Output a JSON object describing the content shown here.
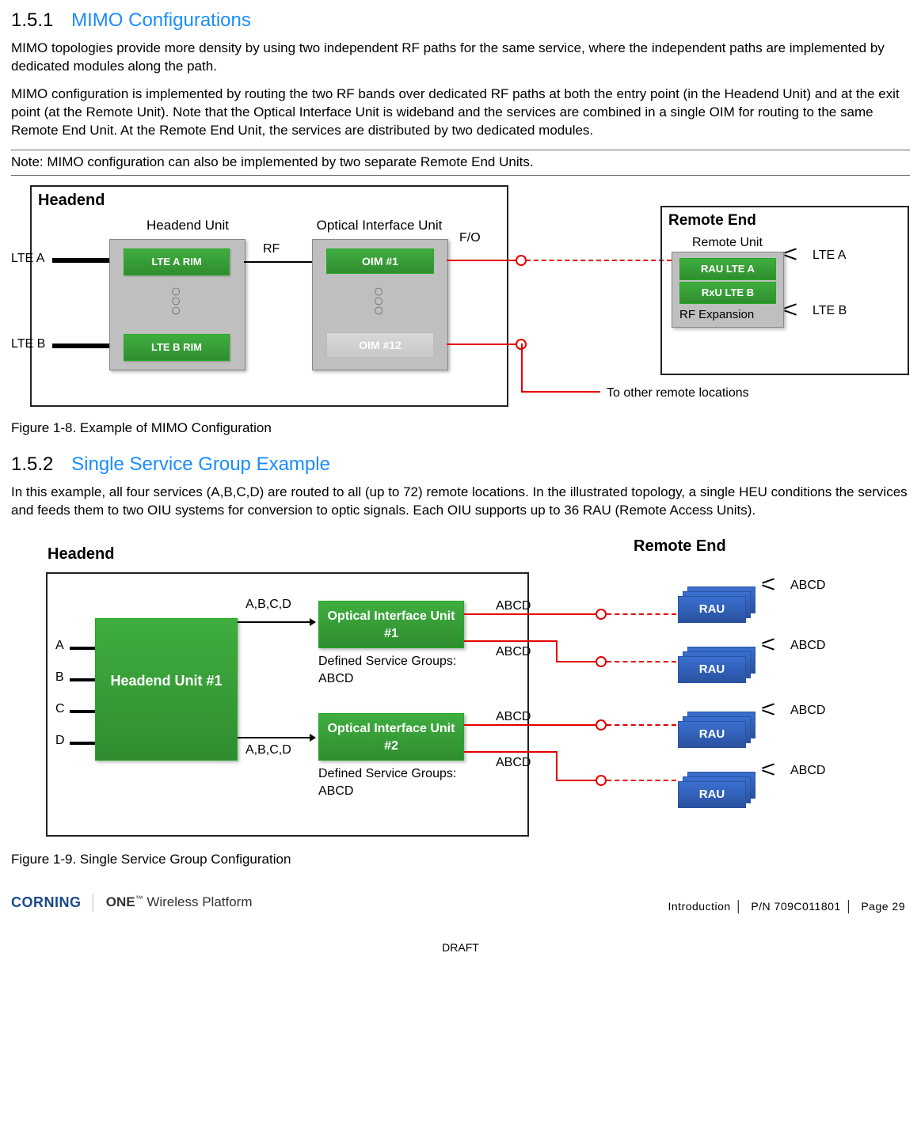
{
  "section1": {
    "num": "1.5.1",
    "title": "MIMO Configurations",
    "para1": "MIMO topologies provide more density by using two independent RF paths for the same service, where the independent paths are implemented by dedicated modules along the path.",
    "para2": "MIMO configuration is implemented by routing the two RF bands over dedicated RF paths at both the entry point (in the Headend Unit) and at the exit point (at the Remote Unit). Note that the Optical Interface Unit is wideband and the services are combined in a single OIM for routing to the same Remote End Unit. At the Remote End Unit, the services are distributed by two dedicated modules.",
    "note": "Note: MIMO configuration can also be implemented by two separate Remote End Units."
  },
  "fig1": {
    "headend": "Headend",
    "headend_unit": "Headend Unit",
    "oiu": "Optical Interface Unit",
    "lteA_in": "LTE A",
    "lteB_in": "LTE B",
    "rimA": "LTE A RIM",
    "rimB": "LTE B RIM",
    "rf": "RF",
    "fo": "F/O",
    "oim1": "OIM #1",
    "oim12": "OIM #12",
    "remote_end": "Remote End",
    "remote_unit": "Remote Unit",
    "rauA": "RAU LTE A",
    "rauB": "RxU LTE B",
    "rf_exp": "RF Expansion",
    "lteA_out": "LTE A",
    "lteB_out": "LTE B",
    "to_other": "To other remote locations",
    "caption": "Figure 1-8. Example of MIMO Configuration"
  },
  "section2": {
    "num": "1.5.2",
    "title": "Single Service Group Example",
    "para1": "In this example, all four services (A,B,C,D) are routed to all (up to 72) remote locations. In the illustrated topology, a single HEU conditions the services and feeds them to two OIU systems for conversion to optic signals. Each OIU supports up to 36 RAU (Remote Access Units)."
  },
  "fig2": {
    "headend": "Headend",
    "remote_end": "Remote End",
    "heu": "Headend Unit #1",
    "A": "A",
    "B": "B",
    "C": "C",
    "D": "D",
    "abcd_in": "A,B,C,D",
    "oiu1": "Optical Interface Unit #1",
    "oiu2": "Optical Interface Unit #2",
    "dsg": "Defined Service Groups: ABCD",
    "abcd": "ABCD",
    "rau": "RAU",
    "caption": "Figure 1-9. Single Service Group Configuration"
  },
  "footer": {
    "brand_c": "CORNING",
    "brand_o": "ONE",
    "brand_t": " Wireless Platform",
    "intro": "Introduction",
    "pn": "P/N 709C011801",
    "page": "Page 29",
    "draft": "DRAFT"
  }
}
